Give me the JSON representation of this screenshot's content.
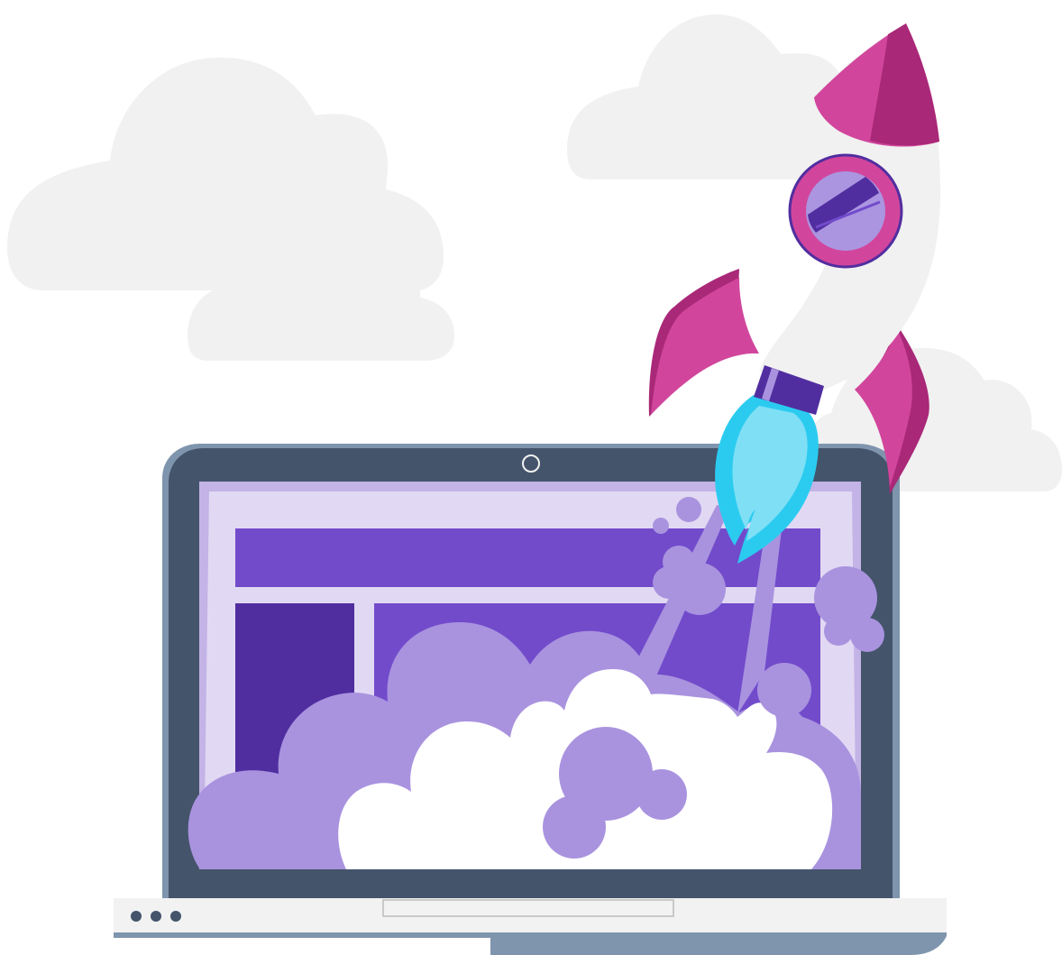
{
  "scene": {
    "background": "#ffffff",
    "colors": {
      "cloud": "#f1f1f1",
      "laptop_frame": "#44546b",
      "laptop_frame_edge": "#7f94ad",
      "laptop_base": "#f2f2f2",
      "screen_bg": "#e1d9f3",
      "screen_border": "#c3b3e6",
      "content_purple": "#724bcb",
      "content_dark_purple": "#512ea0",
      "smoke_purple": "#a993df",
      "rocket_body": "#f1f1f1",
      "rocket_pink": "#d1469c",
      "rocket_pink_dark": "#a92878",
      "window_lavender": "#ab95e1",
      "flame_outer": "#2bcbf0",
      "flame_inner": "#7fdff5"
    },
    "icons": {
      "webcam": "webcam-icon",
      "rocket": "rocket-icon",
      "rocket_window": "porthole-icon"
    },
    "indicator_dots": 3
  }
}
